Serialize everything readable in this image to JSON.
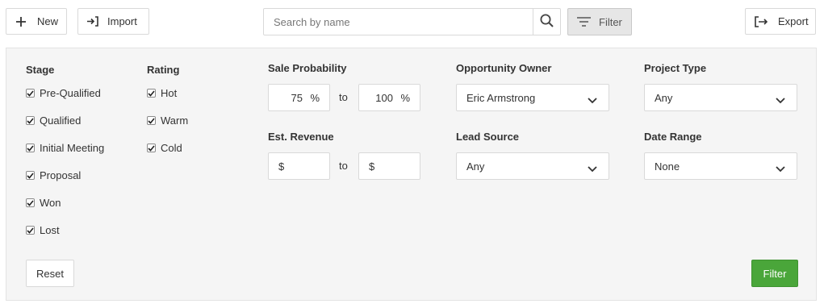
{
  "toolbar": {
    "new_label": "New",
    "import_label": "Import",
    "export_label": "Export",
    "filter_label": "Filter",
    "search_placeholder": "Search by name"
  },
  "filters": {
    "stage": {
      "heading": "Stage",
      "items": [
        {
          "label": "Pre-Qualified",
          "checked": true
        },
        {
          "label": "Qualified",
          "checked": true
        },
        {
          "label": "Initial Meeting",
          "checked": true
        },
        {
          "label": "Proposal",
          "checked": true
        },
        {
          "label": "Won",
          "checked": true
        },
        {
          "label": "Lost",
          "checked": true
        }
      ]
    },
    "rating": {
      "heading": "Rating",
      "items": [
        {
          "label": "Hot",
          "checked": true
        },
        {
          "label": "Warm",
          "checked": true
        },
        {
          "label": "Cold",
          "checked": true
        }
      ]
    },
    "sale_probability": {
      "heading": "Sale Probability",
      "from": "75",
      "to": "100",
      "unit": "%",
      "to_label": "to"
    },
    "est_revenue": {
      "heading": "Est. Revenue",
      "currency": "$",
      "from": "",
      "to": "",
      "to_label": "to"
    },
    "opportunity_owner": {
      "heading": "Opportunity Owner",
      "value": "Eric Armstrong"
    },
    "lead_source": {
      "heading": "Lead Source",
      "value": "Any"
    },
    "project_type": {
      "heading": "Project Type",
      "value": "Any"
    },
    "date_range": {
      "heading": "Date Range",
      "value": "None"
    },
    "reset_label": "Reset",
    "apply_label": "Filter"
  },
  "colors": {
    "accent_green": "#4aa63a",
    "panel_bg": "#f5f5f5"
  }
}
